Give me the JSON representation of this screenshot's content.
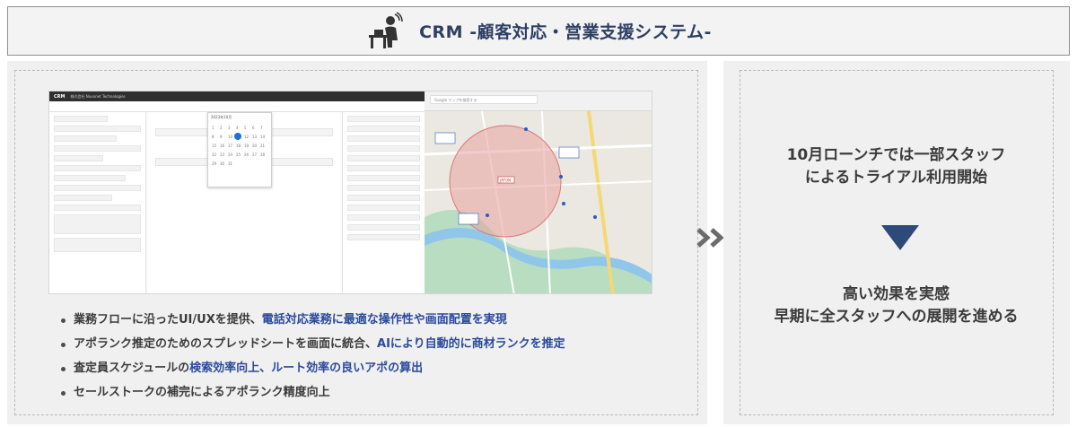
{
  "header": {
    "title": "CRM -顧客対応・営業支援システム-",
    "icon": "person-at-phone-desk-icon"
  },
  "screenshot": {
    "crm": {
      "logo": "CRM",
      "app_name": "株式会社 Nuvonet Technologies",
      "calendar_title": "2023年10月"
    },
    "map": {
      "search_placeholder": "Google マップを検索する",
      "center_label": "JATON",
      "pins": [
        "最寄り駅\nアポランク",
        "近辺物件\nアポランク",
        "訪問先A\nアポランク"
      ]
    }
  },
  "bullets": [
    {
      "plain": "業務フローに沿ったUI/UXを提供、",
      "highlight": "電話対応業務に最適な操作性や画面配置を実現"
    },
    {
      "plain": "アポランク推定のためのスプレッドシートを画面に統合、",
      "highlight": "AIにより自動的に商材ランクを推定"
    },
    {
      "plain": "査定員スケジュールの",
      "highlight": "検索効率向上、ルート効率の良いアポの算出"
    },
    {
      "plain": "セールストークの補完によるアポランク精度向上",
      "highlight": ""
    }
  ],
  "right_panel": {
    "line1a": "10月ローンチでは一部スタッフ",
    "line1b": "によるトライアル利用開始",
    "line2a": "高い効果を実感",
    "line2b": "早期に全スタッフへの展開を進める"
  },
  "colors": {
    "title": "#2e3f63",
    "highlight": "#2a4a9c",
    "arrow": "#2e4a7a",
    "chevron": "#6b6b6b"
  }
}
